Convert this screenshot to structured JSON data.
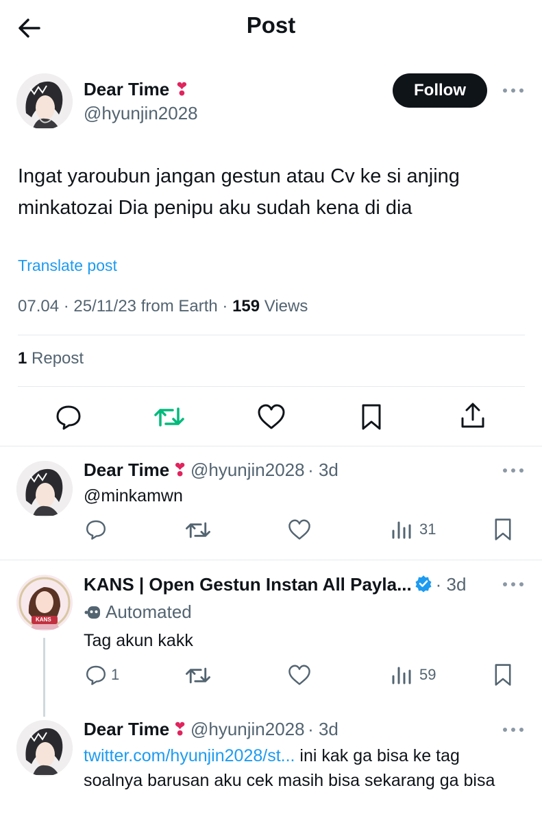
{
  "header": {
    "title": "Post"
  },
  "post": {
    "author": {
      "name": "Dear Time",
      "handle": "@hyunjin2028"
    },
    "follow_label": "Follow",
    "text": "Ingat yaroubun jangan gestun atau Cv ke si anjing minkatozai Dia penipu aku sudah kena di dia",
    "translate_label": "Translate post",
    "meta": {
      "time_date": "07.04 · 25/11/23 from Earth · ",
      "views_count": "159",
      "views_label": " Views"
    },
    "reposts": {
      "count": "1",
      "label": " Repost"
    }
  },
  "replies": [
    {
      "name": "Dear Time",
      "handle": "@hyunjin2028",
      "time": "· 3d",
      "text": "@minkamwn",
      "stats": {
        "views": "31"
      }
    },
    {
      "name": "KANS | Open Gestun Instan All Payla...",
      "time": "· 3d",
      "automated_label": "Automated",
      "text": "Tag akun kakk",
      "stats": {
        "replies": "1",
        "views": "59"
      },
      "avatar_label": "KANS"
    },
    {
      "name": "Dear Time",
      "handle": "@hyunjin2028",
      "time": "· 3d",
      "link": "twitter.com/hyunjin2028/st...",
      "text_after_link": " ini kak ga bisa ke tag soalnya barusan aku cek masih bisa sekarang ga bisa"
    }
  ],
  "colors": {
    "text": "#0f1419",
    "secondary": "#536471",
    "link": "#1d9bf0",
    "repost_green": "#00ba7c",
    "heart": "#e0245e",
    "follow_bg": "#0f1419"
  },
  "icons": [
    "back-arrow-icon",
    "more-icon",
    "reply-icon",
    "repost-icon",
    "like-icon",
    "bookmark-icon",
    "share-icon",
    "views-icon",
    "verified-badge-icon",
    "robot-icon",
    "heart-emoji-icon"
  ]
}
